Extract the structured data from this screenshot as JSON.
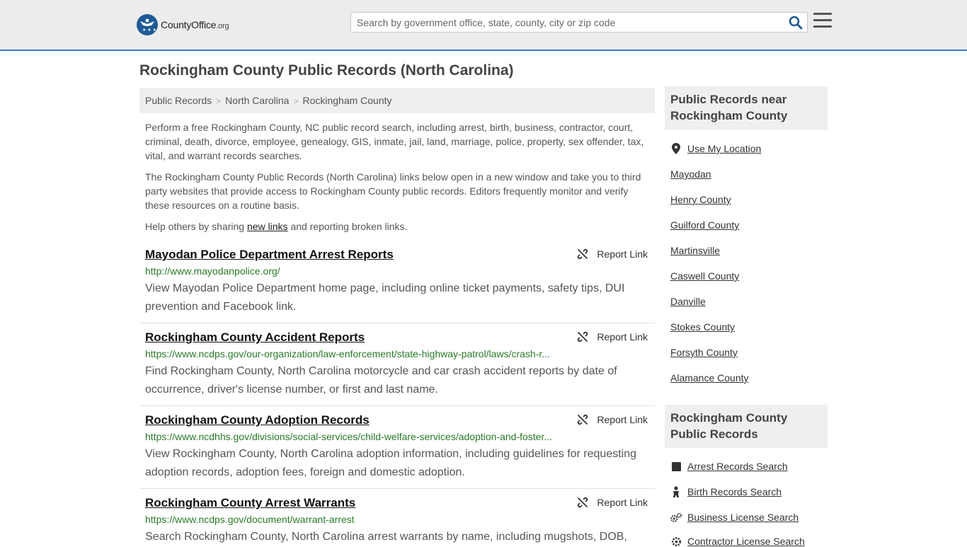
{
  "header": {
    "logo_text": "CountyOffice",
    "logo_suffix": ".org",
    "search_placeholder": "Search by government office, state, county, city or zip code"
  },
  "page_title": "Rockingham County Public Records (North Carolina)",
  "breadcrumb": [
    "Public Records",
    "North Carolina",
    "Rockingham County"
  ],
  "intro": {
    "p1": "Perform a free Rockingham County, NC public record search, including arrest, birth, business, contractor, court, criminal, death, divorce, employee, genealogy, GIS, inmate, jail, land, marriage, police, property, sex offender, tax, vital, and warrant records searches.",
    "p2": "The Rockingham County Public Records (North Carolina) links below open in a new window and take you to third party websites that provide access to Rockingham County public records. Editors frequently monitor and verify these resources on a routine basis.",
    "p3_before": "Help others by sharing ",
    "p3_link": "new links",
    "p3_after": " and reporting broken links."
  },
  "report_label": "Report Link",
  "records": [
    {
      "title": "Mayodan Police Department Arrest Reports",
      "url": "http://www.mayodanpolice.org/",
      "desc": "View Mayodan Police Department home page, including online ticket payments, safety tips, DUI prevention and Facebook link."
    },
    {
      "title": "Rockingham County Accident Reports",
      "url": "https://www.ncdps.gov/our-organization/law-enforcement/state-highway-patrol/laws/crash-r...",
      "desc": "Find Rockingham County, North Carolina motorcycle and car crash accident reports by date of occurrence, driver's license number, or first and last name."
    },
    {
      "title": "Rockingham County Adoption Records",
      "url": "https://www.ncdhhs.gov/divisions/social-services/child-welfare-services/adoption-and-foster...",
      "desc": "View Rockingham County, North Carolina adoption information, including guidelines for requesting adoption records, adoption fees, foreign and domestic adoption."
    },
    {
      "title": "Rockingham County Arrest Warrants",
      "url": "https://www.ncdps.gov/document/warrant-arrest",
      "desc": "Search Rockingham County, North Carolina arrest warrants by name, including mugshots, DOB,"
    }
  ],
  "sidebar": {
    "near_title": "Public Records near Rockingham County",
    "use_location": "Use My Location",
    "near_links": [
      "Mayodan",
      "Henry County",
      "Guilford County",
      "Martinsville",
      "Caswell County",
      "Danville",
      "Stokes County",
      "Forsyth County",
      "Alamance County"
    ],
    "county_title": "Rockingham County Public Records",
    "county_links": [
      {
        "label": "Arrest Records Search",
        "icon": "square-icon"
      },
      {
        "label": "Birth Records Search",
        "icon": "baby-icon"
      },
      {
        "label": "Business License Search",
        "icon": "gears-icon"
      },
      {
        "label": "Contractor License Search",
        "icon": "gear-icon"
      }
    ]
  },
  "colors": {
    "brand": "#1f5a96",
    "header_bg": "#ececec",
    "header_border": "#3a7bbf",
    "url_green": "#2a7a2a",
    "box_bg": "#efefef"
  }
}
